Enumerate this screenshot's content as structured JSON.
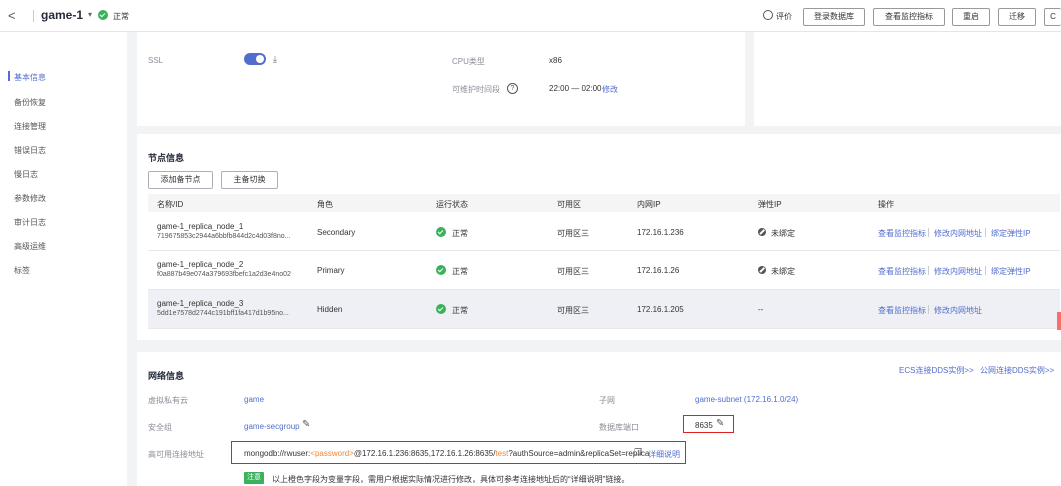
{
  "header": {
    "back": "<",
    "instance_name": "game-1",
    "caret": "▾",
    "status": "正常",
    "rate": "评价",
    "buttons": [
      "登录数据库",
      "查看监控指标",
      "重启",
      "迁移",
      "C"
    ]
  },
  "sidebar": {
    "items": [
      "基本信息",
      "备份恢复",
      "连接管理",
      "错误日志",
      "慢日志",
      "参数修改",
      "审计日志",
      "高级运维",
      "标签"
    ]
  },
  "basic": {
    "ssl_label": "SSL",
    "cpu_label": "CPU类型",
    "cpu_value": "x86",
    "maint_label": "可维护时间段",
    "maint_value": "22:00 — 02:00",
    "maint_link": "修改"
  },
  "nodes": {
    "title": "节点信息",
    "add_button": "添加备节点",
    "switch_button": "主备切换",
    "columns": [
      "名称/ID",
      "角色",
      "运行状态",
      "可用区",
      "内网IP",
      "弹性IP",
      "操作"
    ],
    "rows": [
      {
        "name": "game-1_replica_node_1",
        "id": "719675853c2944a6bbfb844d2c4d03f8no...",
        "role": "Secondary",
        "status": "正常",
        "zone": "可用区三",
        "ip": "172.16.1.236",
        "eip": "未绑定",
        "actions": [
          "查看监控指标",
          "修改内网地址",
          "绑定弹性IP"
        ]
      },
      {
        "name": "game-1_replica_node_2",
        "id": "f0a887b49e074a379693fbefc1a2d3e4no02",
        "role": "Primary",
        "status": "正常",
        "zone": "可用区三",
        "ip": "172.16.1.26",
        "eip": "未绑定",
        "actions": [
          "查看监控指标",
          "修改内网地址",
          "绑定弹性IP"
        ]
      },
      {
        "name": "game-1_replica_node_3",
        "id": "5dd1e7578d2744c191bff1fa417d1b95no...",
        "role": "Hidden",
        "status": "正常",
        "zone": "可用区三",
        "ip": "172.16.1.205",
        "eip": "--",
        "actions": [
          "查看监控指标",
          "修改内网地址"
        ]
      }
    ]
  },
  "network": {
    "title": "网络信息",
    "links": [
      "ECS连接DDS实例>>",
      "公网连接DDS实例>>"
    ],
    "vpc_label": "虚拟私有云",
    "vpc_value": "game",
    "subnet_label": "子网",
    "subnet_value": "game-subnet (172.16.1.0/24)",
    "sg_label": "安全组",
    "sg_value": "game-secgroup",
    "port_label": "数据库端口",
    "port_value": "8635",
    "ha_label": "高可用连接地址",
    "uri_prefix": "mongodb://rwuser:",
    "uri_password": "<password>",
    "uri_hosts": "@172.16.1.236:8635,172.16.1.26:8635/",
    "uri_db": "test",
    "uri_suffix": "?authSource=admin&replicaSet=replica",
    "detail_link": "详细说明",
    "note_badge": "注意",
    "note_text": "以上橙色字段为变量字段，需用户根据实际情况进行修改，具体可参考连接地址后的“详细说明”链接。"
  },
  "colors": {
    "accent": "#526ecc",
    "ok": "#3ab15b",
    "highlight": "#e02020",
    "variable": "#f0883a"
  }
}
